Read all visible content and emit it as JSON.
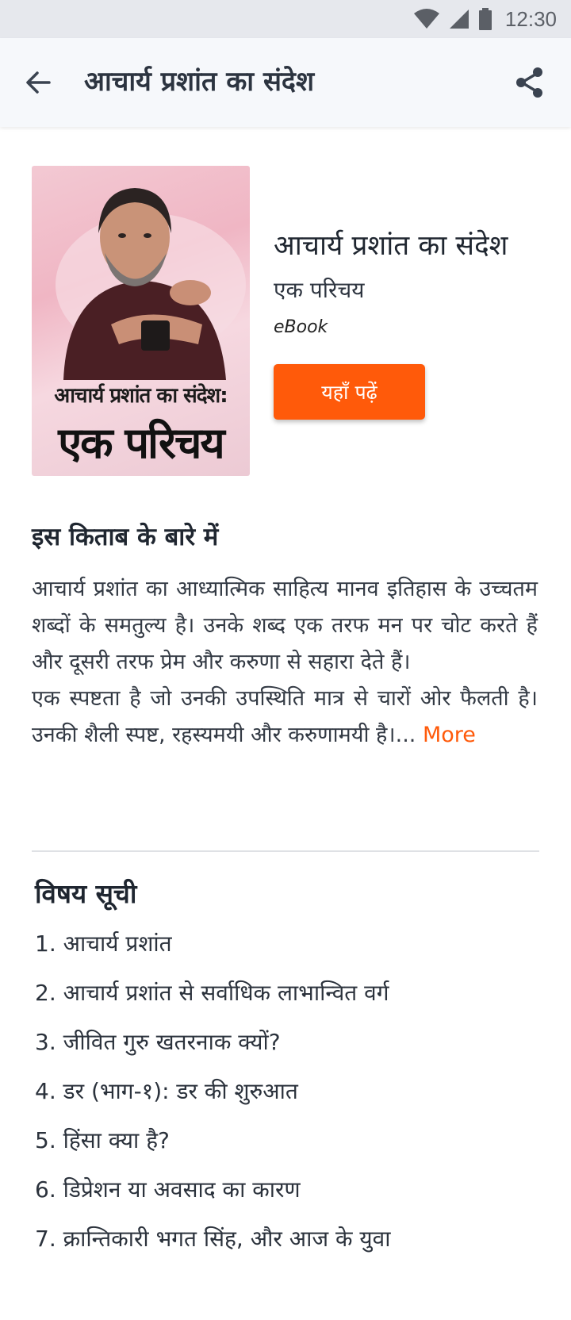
{
  "status_bar": {
    "time": "12:30",
    "icons": [
      "wifi-icon",
      "signal-icon",
      "battery-icon"
    ]
  },
  "app_bar": {
    "title": "आचार्य प्रशांत का संदेश",
    "back_icon": "arrow-left-icon",
    "share_icon": "share-icon"
  },
  "book": {
    "cover": {
      "title_top": "आचार्य प्रशांत का संदेश:",
      "title_main": "एक परिचय"
    },
    "title": "आचार्य प्रशांत का संदेश",
    "subtitle": "एक परिचय",
    "type": "eBook",
    "read_button": "यहाँ पढ़ें"
  },
  "about": {
    "heading": "इस किताब के बारे में",
    "paragraph1": "आचार्य प्रशांत का आध्यात्मिक साहित्य मानव इतिहास के उच्चतम शब्दों के समतुल्य है। उनके शब्द एक तरफ मन पर चोट करते हैं और दूसरी तरफ प्रेम और करुणा से सहारा देते हैं।",
    "paragraph2": "एक स्पष्टता है जो उनकी उपस्थिति मात्र से चारों ओर फैलती है। उनकी शैली स्पष्ट, रहस्यमयी और करुणामयी है।...",
    "more_label": "More"
  },
  "toc": {
    "heading": "विषय सूची",
    "items": [
      "1. आचार्य प्रशांत",
      "2. आचार्य प्रशांत से सर्वाधिक लाभान्वित वर्ग",
      "3. जीवित गुरु खतरनाक क्यों?",
      "4. डर (भाग-१): डर की शुरुआत",
      "5. हिंसा क्या है?",
      "6. डिप्रेशन या अवसाद का कारण",
      "7. क्रान्तिकारी भगत सिंह, और आज के युवा"
    ]
  },
  "colors": {
    "accent": "#ff5a0a",
    "app_bar_bg": "#f6f8fb",
    "status_bar_bg": "#e6e8ed",
    "text_primary": "#1f2630"
  }
}
